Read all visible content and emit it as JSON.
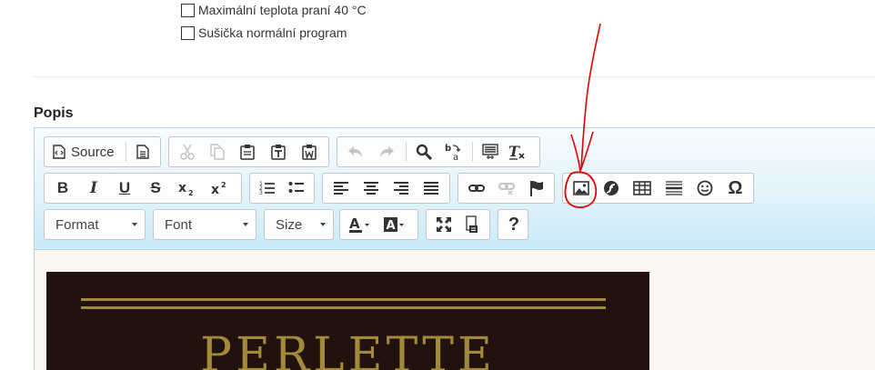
{
  "checkboxes": [
    {
      "label": "Maximální teplota praní 40 °C",
      "checked": false
    },
    {
      "label": "Sušička normální program",
      "checked": false
    }
  ],
  "section_title": "Popis",
  "toolbar": {
    "source_label": "Source",
    "combos": {
      "format": "Format",
      "font": "Font",
      "size": "Size"
    },
    "icons": {
      "row1": [
        "source-icon",
        "templates-icon",
        "cut-icon",
        "copy-icon",
        "paste-icon",
        "paste-text-icon",
        "paste-word-icon",
        "undo-icon",
        "redo-icon",
        "find-icon",
        "replace-icon",
        "select-all-icon",
        "remove-format-icon"
      ],
      "row2": [
        "bold-icon",
        "italic-icon",
        "underline-icon",
        "strike-icon",
        "subscript-icon",
        "superscript-icon",
        "numbered-list-icon",
        "bulleted-list-icon",
        "align-left-icon",
        "align-center-icon",
        "align-right-icon",
        "justify-icon",
        "link-icon",
        "unlink-icon",
        "anchor-icon",
        "image-icon",
        "flash-icon",
        "table-icon",
        "horizontal-line-icon",
        "smiley-icon",
        "special-char-icon"
      ],
      "row3": [
        "text-color-icon",
        "background-color-icon",
        "maximize-icon",
        "show-blocks-icon",
        "help-icon"
      ]
    }
  },
  "content": {
    "banner_title": "PERLETTE"
  },
  "colors": {
    "toolbar_gradient_top": "#f7fcff",
    "toolbar_gradient_bottom": "#c9eaf8",
    "banner_bg": "#22120d",
    "banner_gold": "#a38a3b",
    "annotation_red": "#e00000"
  }
}
